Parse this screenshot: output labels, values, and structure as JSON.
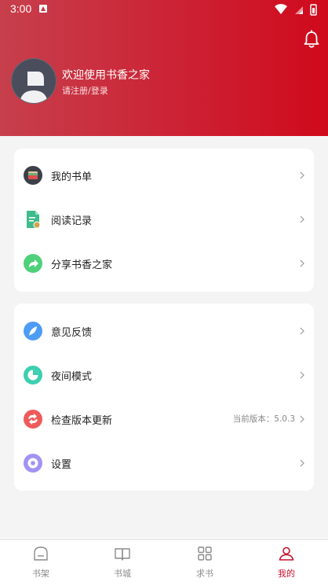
{
  "status": {
    "time": "3:00"
  },
  "header": {
    "welcome": "欢迎使用书香之家",
    "login_prompt": "请注册/登录"
  },
  "menu_group_1": [
    {
      "label": "我的书单",
      "icon": "booklist-wallet-icon"
    },
    {
      "label": "阅读记录",
      "icon": "reading-record-icon"
    },
    {
      "label": "分享书香之家",
      "icon": "share-icon"
    }
  ],
  "menu_group_2": [
    {
      "label": "意见反馈",
      "icon": "feedback-feather-icon"
    },
    {
      "label": "夜间模式",
      "icon": "night-mode-icon"
    },
    {
      "label": "检查版本更新",
      "icon": "update-icon",
      "extra": "当前版本：5.0.3"
    },
    {
      "label": "设置",
      "icon": "settings-icon"
    }
  ],
  "tabs": [
    {
      "label": "书架",
      "icon": "bookshelf-icon",
      "active": false
    },
    {
      "label": "书城",
      "icon": "book-open-icon",
      "active": false
    },
    {
      "label": "求书",
      "icon": "grid-icon",
      "active": false
    },
    {
      "label": "我的",
      "icon": "user-icon",
      "active": true
    }
  ],
  "colors": {
    "accent": "#c8102e",
    "header_start": "#c73f4c",
    "header_end": "#cf0a1c"
  }
}
